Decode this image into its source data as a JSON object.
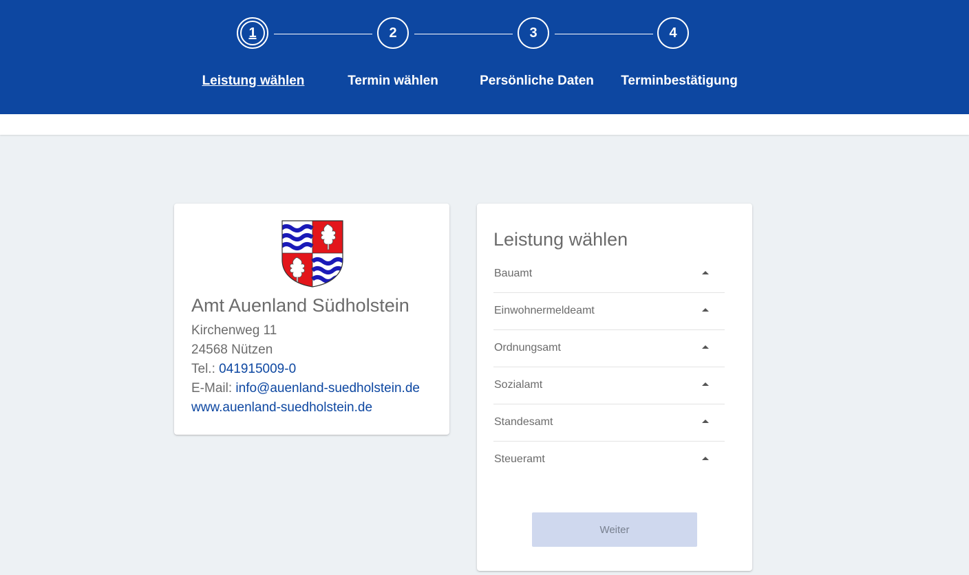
{
  "colors": {
    "brand": "#0d47a1",
    "background": "#edf1f4",
    "text_muted": "#6b6b6b",
    "link": "#0d47a1",
    "button_disabled": "#cfd8ee",
    "crest_blue": "#1a1ab8",
    "crest_red": "#e3161b"
  },
  "stepper": {
    "steps": [
      {
        "number": "1",
        "label": "Leistung wählen",
        "state": "active"
      },
      {
        "number": "2",
        "label": "Termin wählen",
        "state": "inactive"
      },
      {
        "number": "3",
        "label": "Persönliche Daten",
        "state": "inactive"
      },
      {
        "number": "4",
        "label": "Terminbestätigung",
        "state": "inactive"
      }
    ]
  },
  "office": {
    "crest_icon": "coat-of-arms-icon",
    "name": "Amt Auenland Südholstein",
    "street": "Kirchenweg 11",
    "city": "24568 Nützen",
    "phone_label": "Tel.:",
    "phone": "041915009-0",
    "email_label": "E-Mail:",
    "email": "info@auenland-suedholstein.de",
    "website": "www.auenland-suedholstein.de"
  },
  "services": {
    "title": "Leistung wählen",
    "expand_icon": "caret-up-icon",
    "items": [
      {
        "label": "Bauamt"
      },
      {
        "label": "Einwohnermeldeamt"
      },
      {
        "label": "Ordnungsamt"
      },
      {
        "label": "Sozialamt"
      },
      {
        "label": "Standesamt"
      },
      {
        "label": "Steueramt"
      }
    ],
    "next_label": "Weiter",
    "next_enabled": false
  }
}
